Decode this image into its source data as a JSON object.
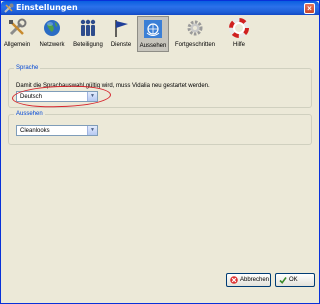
{
  "window": {
    "title": "Einstellungen"
  },
  "toolbar": {
    "items": [
      {
        "label": "Allgemein",
        "icon": "tools-icon",
        "active": false
      },
      {
        "label": "Netzwerk",
        "icon": "globe-icon",
        "active": false
      },
      {
        "label": "Beteiligung",
        "icon": "users-icon",
        "active": false
      },
      {
        "label": "Dienste",
        "icon": "flag-icon",
        "active": false
      },
      {
        "label": "Aussehen",
        "icon": "un-emblem-icon",
        "active": true
      },
      {
        "label": "Fortgeschritten",
        "icon": "gear-icon",
        "active": false
      },
      {
        "label": "Hilfe",
        "icon": "help-icon",
        "active": false
      }
    ]
  },
  "language_group": {
    "title": "Sprache",
    "hint": "Damit die Sprachauswahl gültig wird, muss Vidalia neu gestartet werden.",
    "selected": "Deutsch"
  },
  "style_group": {
    "title": "Aussehen",
    "selected": "Cleanlooks"
  },
  "buttons": {
    "cancel": "Abbrechen",
    "ok": "OK"
  },
  "colors": {
    "titlebar": "#1d5ed6",
    "group_title": "#0046d5",
    "annotation": "#d6262e"
  }
}
